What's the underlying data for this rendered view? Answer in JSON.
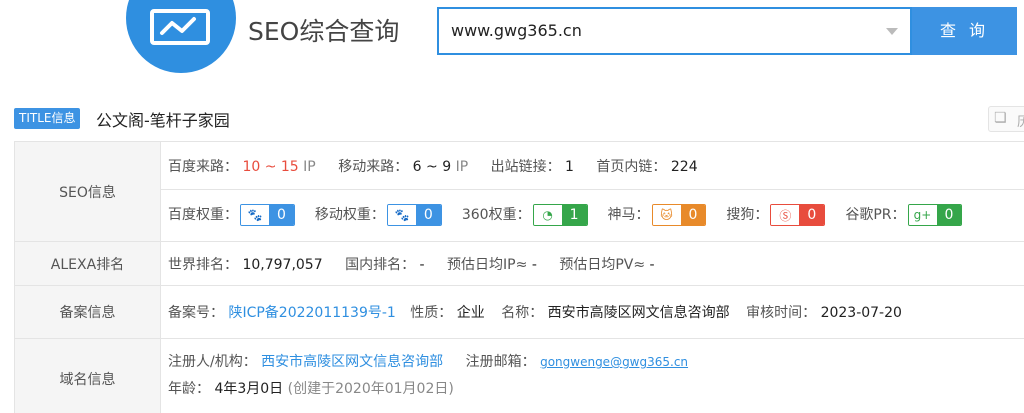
{
  "header": {
    "site_title": "SEO综合查询",
    "search_value": "www.gwg365.cn",
    "search_button": "查 询"
  },
  "title_row": {
    "tag": "TITLE信息",
    "value": "公文阁-笔杆子家园",
    "share_label": "历"
  },
  "seo": {
    "label": "SEO信息",
    "baidu_traffic_label": "百度来路：",
    "baidu_traffic_value": "10 ~ 15",
    "baidu_traffic_unit": "IP",
    "mobile_traffic_label": "移动来路：",
    "mobile_traffic_value": "6 ~ 9",
    "mobile_traffic_unit": "IP",
    "outbound_label": "出站链接：",
    "outbound_value": "1",
    "inbound_label": "首页内链：",
    "inbound_value": "224",
    "ranks": [
      {
        "label": "百度权重：",
        "value": "0",
        "color": "#3d93e3",
        "icon": "paw-icon"
      },
      {
        "label": "移动权重：",
        "value": "0",
        "color": "#3d93e3",
        "icon": "paw-icon"
      },
      {
        "label": "360权重：",
        "value": "1",
        "color": "#35a64a",
        "icon": "360-icon"
      },
      {
        "label": "神马：",
        "value": "0",
        "color": "#e88a2a",
        "icon": "shenma-icon"
      },
      {
        "label": "搜狗：",
        "value": "0",
        "color": "#e84c3d",
        "icon": "sogou-icon"
      },
      {
        "label": "谷歌PR：",
        "value": "0",
        "color": "#35a64a",
        "icon": "google-plus-icon"
      }
    ]
  },
  "alexa": {
    "label": "ALEXA排名",
    "world_label": "世界排名：",
    "world_value": "10,797,057",
    "domestic_label": "国内排名：",
    "domestic_value": "-",
    "daily_ip_label": "预估日均IP≈",
    "daily_ip_value": "-",
    "daily_pv_label": "预估日均PV≈",
    "daily_pv_value": "-"
  },
  "icp": {
    "label": "备案信息",
    "number_label": "备案号：",
    "number_value": "陕ICP备2022011139号-1",
    "nature_label": "性质：",
    "nature_value": "企业",
    "name_label": "名称：",
    "name_value": "西安市高陵区网文信息咨询部",
    "audit_label": "审核时间：",
    "audit_value": "2023-07-20"
  },
  "domain": {
    "label": "域名信息",
    "registrant_label": "注册人/机构：",
    "registrant_value": "西安市高陵区网文信息咨询部",
    "email_label": "注册邮箱：",
    "email_value": "gongwenge@gwg365.cn",
    "age_label": "年龄：",
    "age_value": "4年3月0日",
    "created_note": "(创建于2020年01月02日)"
  }
}
